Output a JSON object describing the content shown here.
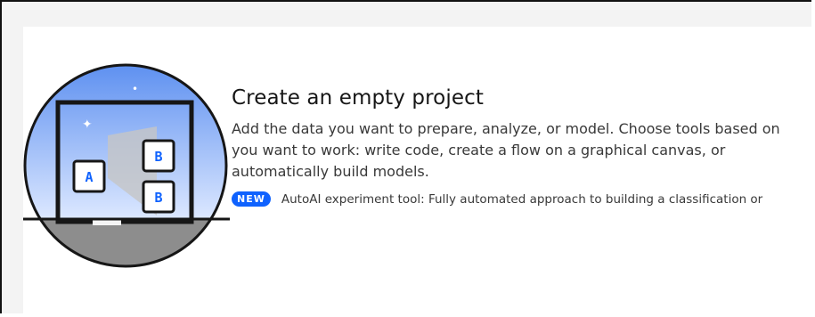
{
  "project_card": {
    "title": "Create an empty project",
    "description_lines": [
      "Add the data you want to prepare, analyze, or model. Choose tools based on",
      "you want to work: write code, create a flow on a graphical canvas, or",
      "automatically build models."
    ],
    "new_badge": "NEW",
    "new_feature_text": "AutoAI experiment tool: Fully automated approach to building a classification or",
    "illustration": {
      "box_a_label": "A",
      "box_b_top_label": "B",
      "box_b_bottom_label": "B",
      "sky_color": "#a6c8ff",
      "ground_color": "#8d8d8d",
      "badge_color": "#0f62fe"
    }
  }
}
